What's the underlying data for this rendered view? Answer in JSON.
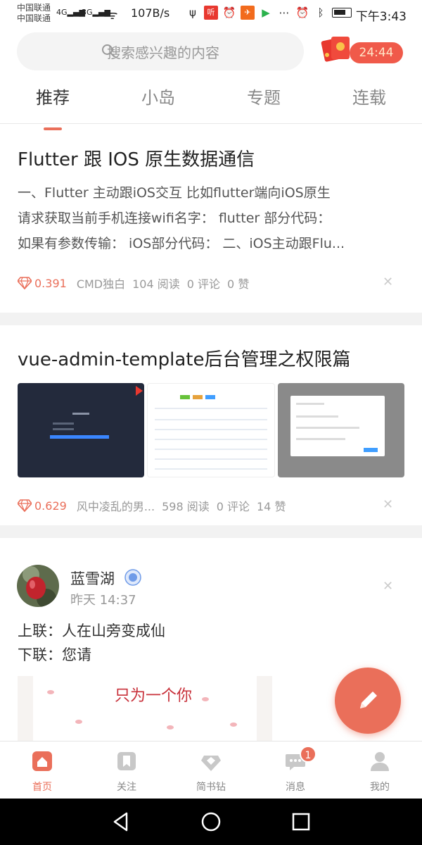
{
  "status_bar": {
    "carrier_1": "中国联通",
    "carrier_2": "中国联通",
    "net_1": "4G",
    "net_2": "3G",
    "speed": "107B/s",
    "time": "下午3:43"
  },
  "search": {
    "placeholder": "搜索感兴趣的内容",
    "icon": "search-icon"
  },
  "red_packet": {
    "countdown": "24:44"
  },
  "tabs": [
    {
      "label": "推荐",
      "active": true
    },
    {
      "label": "小岛",
      "active": false
    },
    {
      "label": "专题",
      "active": false
    },
    {
      "label": "连载",
      "active": false
    }
  ],
  "articles": [
    {
      "title": "Flutter 跟 IOS 原生数据通信",
      "abstract_lines": [
        "一、Flutter 主动跟iOS交互 比如flutter端向iOS原生",
        "请求获取当前手机连接wifi名字： flutter 部分代码：",
        "如果有参数传输： iOS部分代码： 二、iOS主动跟Flu..."
      ],
      "score": "0.391",
      "author": "CMD独白",
      "reads": "104 阅读",
      "comments": "0 评论",
      "likes": "0 赞"
    },
    {
      "title": "vue-admin-template后台管理之权限篇",
      "score": "0.629",
      "author": "风中凌乱的男...",
      "reads": "598 阅读",
      "comments": "0 评论",
      "likes": "14 赞"
    }
  ],
  "post": {
    "author": "蓝雪湖",
    "time": "昨天 14:37",
    "line_1": "上联：人在山旁变成仙",
    "line_2": "下联：您请",
    "image_text": "只为一个你"
  },
  "bottom_nav": [
    {
      "label": "首页",
      "icon": "home-icon",
      "active": true
    },
    {
      "label": "关注",
      "icon": "bookmark-icon",
      "active": false
    },
    {
      "label": "简书钻",
      "icon": "diamond-icon",
      "active": false
    },
    {
      "label": "消息",
      "icon": "message-icon",
      "active": false,
      "badge": "1"
    },
    {
      "label": "我的",
      "icon": "user-icon",
      "active": false
    }
  ],
  "colors": {
    "accent": "#ea6f5a",
    "text": "#333333",
    "muted": "#999999"
  }
}
